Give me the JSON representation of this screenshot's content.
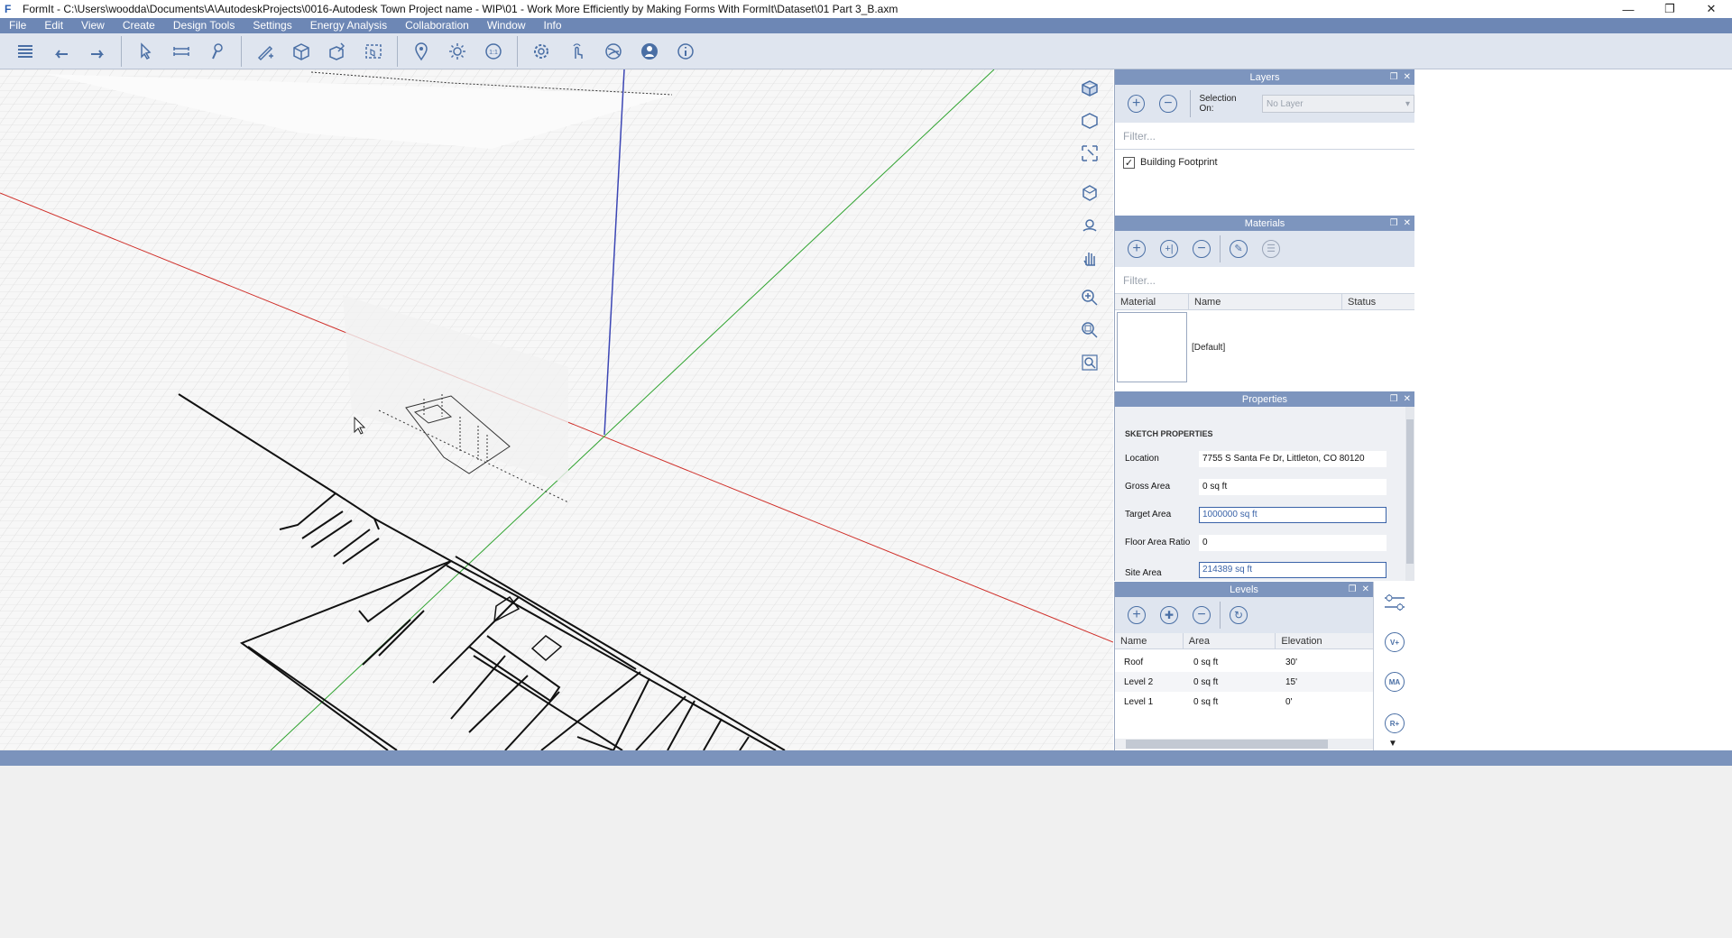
{
  "window": {
    "title": "FormIt - C:\\Users\\woodda\\Documents\\A\\AutodeskProjects\\0016-Autodesk Town Project name - WIP\\01 - Work More Efficiently by Making Forms With FormIt\\Dataset\\01 Part 3_B.axm",
    "logo": "F"
  },
  "menu": [
    "File",
    "Edit",
    "View",
    "Create",
    "Design Tools",
    "Settings",
    "Energy Analysis",
    "Collaboration",
    "Window",
    "Info"
  ],
  "toolbar_icons": [
    "list-icon",
    "undo-icon",
    "redo-icon",
    "select-icon",
    "dimension-icon",
    "paint-icon",
    "sketch-icon",
    "cube-icon",
    "tools-icon",
    "group-icon",
    "location-icon",
    "sun-icon",
    "scale-icon",
    "settings-icon",
    "touch-icon",
    "share-icon",
    "user-icon",
    "info-icon"
  ],
  "toolbar_scale_label": "1:1",
  "layers": {
    "title": "Layers",
    "selection_label": "Selection On:",
    "selection_value": "No Layer",
    "filter_placeholder": "Filter...",
    "items": [
      {
        "label": "Building Footprint",
        "checked": true
      }
    ]
  },
  "materials": {
    "title": "Materials",
    "filter_placeholder": "Filter...",
    "columns": [
      "Material",
      "Name",
      "Status"
    ],
    "rows": [
      {
        "name": "[Default]",
        "status": ""
      }
    ]
  },
  "properties": {
    "title": "Properties",
    "section": "SKETCH PROPERTIES",
    "rows": [
      {
        "label": "Location",
        "value": "7755 S Santa Fe Dr, Littleton, CO 80120"
      },
      {
        "label": "Gross Area",
        "value": "0 sq ft"
      },
      {
        "label": "Target Area",
        "value": "1000000 sq ft"
      },
      {
        "label": "Floor Area Ratio",
        "value": "0"
      },
      {
        "label": "Site Area",
        "value": "214389 sq ft"
      }
    ]
  },
  "levels": {
    "title": "Levels",
    "columns": [
      "Name",
      "Area",
      "Elevation"
    ],
    "rows": [
      {
        "name": "Roof",
        "area": "0 sq ft",
        "elevation": "30'"
      },
      {
        "name": "Level 2",
        "area": "0 sq ft",
        "elevation": "15'"
      },
      {
        "name": "Level 1",
        "area": "0 sq ft",
        "elevation": "0'"
      }
    ]
  },
  "side_buttons": [
    "V+",
    "MA",
    "R+"
  ],
  "colors": {
    "menu": "#6d87b5",
    "panel_header": "#7d95be",
    "accent": "#3a63a8",
    "x_axis": "#d0302a",
    "y_axis": "#2fa32f",
    "z_axis": "#3c46b4"
  }
}
